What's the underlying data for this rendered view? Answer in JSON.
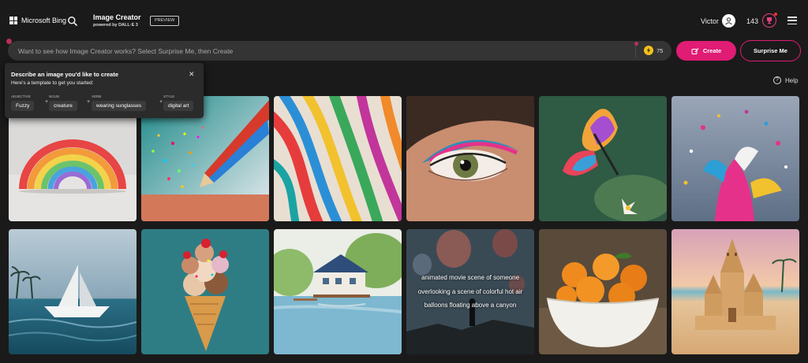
{
  "header": {
    "brand": "Microsoft Bing",
    "product_title": "Image Creator",
    "product_subtitle": "powered by DALL·E 3",
    "preview_badge": "PREVIEW",
    "user_name": "Victor",
    "rewards_count": "143",
    "icons": [
      "microsoft-logo-icon",
      "search-icon",
      "user-avatar-icon",
      "rewards-icon",
      "hamburger-menu-icon"
    ]
  },
  "prompt": {
    "placeholder": "Want to see how Image Creator works? Select Surprise Me, then Create",
    "value": "",
    "boosts": "75",
    "create_label": "Create",
    "surprise_label": "Surprise Me"
  },
  "help": {
    "label": "Help"
  },
  "tooltip": {
    "title": "Describe an image you'd like to create",
    "subtitle": "Here's a template to get you started:",
    "fields": [
      {
        "label": "ADJECTIVE",
        "value": "Fuzzy"
      },
      {
        "label": "NOUN",
        "value": "creature"
      },
      {
        "label": "VERB",
        "value": "wearing sunglasses"
      },
      {
        "label": "STYLE",
        "value": "digital art"
      }
    ]
  },
  "gallery": {
    "hover_caption": "animated movie scene of someone overlooking a scene of colorful hot air balloons floating above a canyon"
  },
  "colors": {
    "background": "#1b1a1a",
    "accent": "#e01c74",
    "prompt_bar": "#343434",
    "boost_coin": "#f3c21b"
  }
}
